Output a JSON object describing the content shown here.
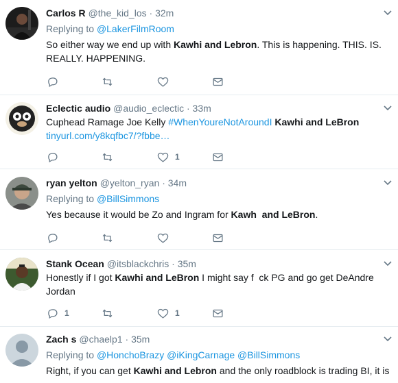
{
  "colors": {
    "link": "#1b95e0",
    "secondary": "#657786",
    "divider": "#e6ecf0",
    "text": "#14171a"
  },
  "tweets": [
    {
      "name": "Carlos R",
      "handle": "@the_kid_los",
      "dot": "·",
      "time": "32m",
      "replying_label": "Replying to",
      "replying_to": [
        "@LakerFilmRoom"
      ],
      "text_before": "So either way we end up with ",
      "text_bold": "Kawhi and Lebron",
      "text_after": ". This is happening. THIS. IS. REALLY. HAPPENING.",
      "reply_count": "",
      "like_count": ""
    },
    {
      "name": "Eclectic audio",
      "handle": "@audio_eclectic",
      "dot": "·",
      "time": "33m",
      "text_before": "Cuphead Ramage Joe Kelly ",
      "hashtag": "#WhenYoureNotAroundI",
      "text_bold": "Kawhi and LeBron",
      "link": "tinyurl.com/y8kqfbc7/?fbbe…",
      "reply_count": "",
      "like_count": "1"
    },
    {
      "name": "ryan yelton",
      "handle": "@yelton_ryan",
      "dot": "·",
      "time": "34m",
      "replying_label": "Replying to",
      "replying_to": [
        "@BillSimmons"
      ],
      "text_before": "Yes because it would be Zo and Ingram for ",
      "text_bold": "Kawh  and LeBron",
      "text_after": ".",
      "reply_count": "",
      "like_count": ""
    },
    {
      "name": "Stank Ocean",
      "handle": "@itsblackchris",
      "dot": "·",
      "time": "35m",
      "text_before": "Honestly if I got ",
      "text_bold": "Kawhi and LeBron",
      "text_after": " I might say f  ck PG and go get DeAndre Jordan",
      "reply_count": "1",
      "like_count": "1"
    },
    {
      "name": "Zach s",
      "handle": "@chaelp1",
      "dot": "·",
      "time": "35m",
      "replying_label": "Replying to",
      "replying_to": [
        "@HonchoBrazy",
        "@iKingCarnage",
        "@BillSimmons"
      ],
      "text_before": "Right, if you can get ",
      "text_bold": "Kawhi and Lebron",
      "text_after": " and the only roadblock is trading BI, it is"
    }
  ]
}
